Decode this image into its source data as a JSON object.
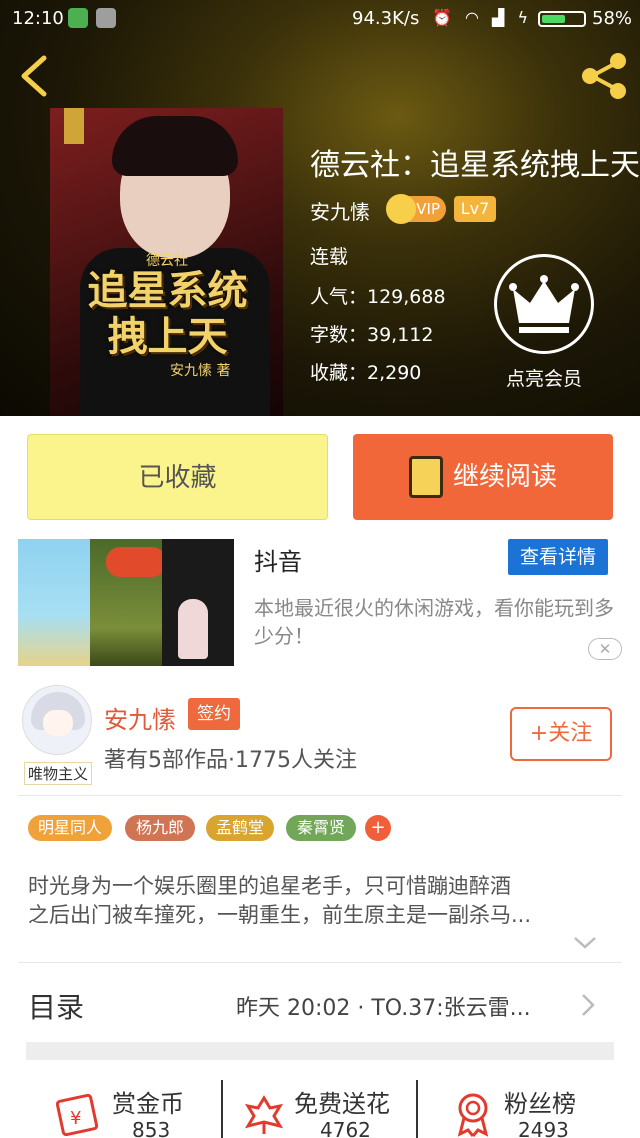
{
  "status_bar": {
    "time": "12:10",
    "network_speed": "94.3K/s",
    "battery_percent": "58%",
    "battery_level": 0.58
  },
  "book": {
    "title": "德云社：追星系统拽上天",
    "author": "安九愫",
    "vip_label": "VIP",
    "level": "Lv7",
    "status": "连载",
    "popularity": "人气：129,688",
    "word_count": "字数：39,112",
    "favorites": "收藏：2,290",
    "cover": {
      "top_label": "德云社",
      "title_line1": "追星系统",
      "title_line2": "拽上天",
      "author": "安九愫 著"
    }
  },
  "membership": {
    "label": "点亮会员",
    "icon": "crown-icon"
  },
  "actions": {
    "collected_label": "已收藏",
    "continue_label": "继续阅读"
  },
  "ad": {
    "title": "抖音",
    "button_label": "查看详情",
    "description": "本地最近很火的休闲游戏，看你能玩到多少分！",
    "close_glyph": "✕"
  },
  "author_card": {
    "name": "安九愫",
    "sign_badge": "签约",
    "stats": "著有5部作品·1775人关注",
    "follow_label": "+关注",
    "avatar_tag": "唯物主义"
  },
  "tags": [
    {
      "label": "明星同人",
      "color": "#f0a23a"
    },
    {
      "label": "杨九郎",
      "color": "#cf7553"
    },
    {
      "label": "孟鹤堂",
      "color": "#d9a42f"
    },
    {
      "label": "秦霄贤",
      "color": "#72a75a"
    }
  ],
  "tag_more": "+",
  "synopsis": {
    "line1": "时光身为一个娱乐圈里的追星老手，只可惜蹦迪醉酒",
    "line2": "之后出门被车撞死，一朝重生，前生原主是一副杀马..."
  },
  "toc": {
    "label": "目录",
    "latest": "昨天 20:02 · TO.37:张云雷..."
  },
  "bottom_stats": [
    {
      "label": "赏金币",
      "count": "853",
      "icon": "red-envelope-icon"
    },
    {
      "label": "免费送花",
      "count": "4762",
      "icon": "flower-icon"
    },
    {
      "label": "粉丝榜",
      "count": "2493",
      "icon": "ribbon-medal-icon"
    }
  ],
  "colors": {
    "accent_orange": "#f2673a",
    "collected_yellow": "#fbf48c",
    "ad_blue": "#1c73d6",
    "author_red": "#e05a3a"
  }
}
